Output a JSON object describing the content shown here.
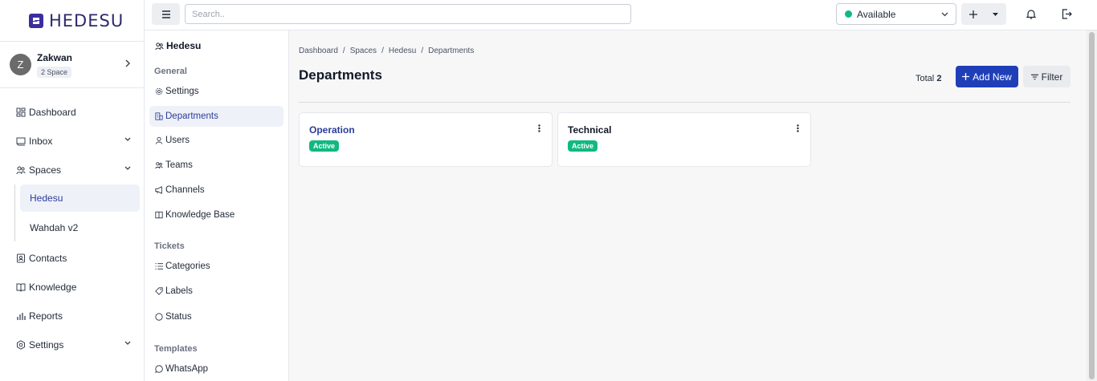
{
  "brand": {
    "name": "HEDESU"
  },
  "user": {
    "initial": "Z",
    "name": "Zakwan",
    "badge": "2 Space"
  },
  "nav": {
    "dashboard": "Dashboard",
    "inbox": "Inbox",
    "spaces": "Spaces",
    "spaces_children": [
      "Hedesu",
      "Wahdah v2"
    ],
    "contacts": "Contacts",
    "knowledge": "Knowledge",
    "reports": "Reports",
    "settings": "Settings"
  },
  "topbar": {
    "search_placeholder": "Search..",
    "status": "Available",
    "status_color": "#10b981"
  },
  "subnav": {
    "title": "Hedesu",
    "general_label": "General",
    "settings": "Settings",
    "departments": "Departments",
    "users": "Users",
    "teams": "Teams",
    "channels": "Channels",
    "knowledge_base": "Knowledge Base",
    "tickets_label": "Tickets",
    "categories": "Categories",
    "labels": "Labels",
    "status": "Status",
    "templates_label": "Templates",
    "whatsapp": "WhatsApp"
  },
  "main": {
    "breadcrumb": [
      "Dashboard",
      "Spaces",
      "Hedesu",
      "Departments"
    ],
    "breadcrumb_sep": "/",
    "title": "Departments",
    "total_label": "Total",
    "total_count": "2",
    "add_label": "Add New",
    "filter_label": "Filter",
    "departments": [
      {
        "name": "Operation",
        "status": "Active"
      },
      {
        "name": "Technical",
        "status": "Active"
      }
    ]
  },
  "colors": {
    "accent": "#1f3fb8",
    "active_badge": "#10b981",
    "brand": "#3b2e9e"
  }
}
